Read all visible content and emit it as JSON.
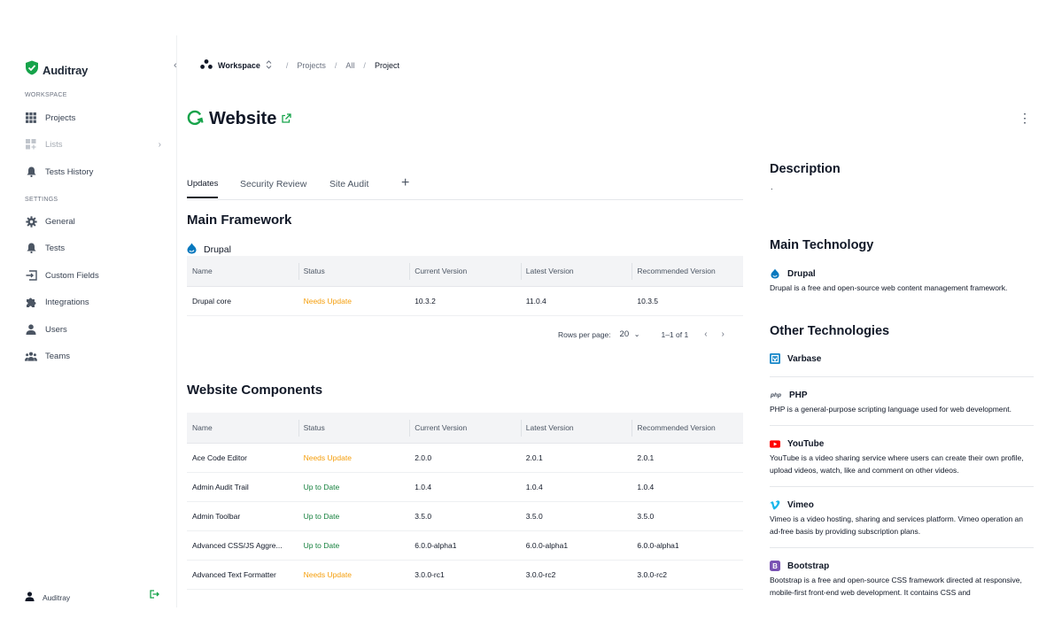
{
  "app": {
    "brand": "Auditray"
  },
  "sidebar": {
    "workspace_label": "WORKSPACE",
    "settings_label": "SETTINGS",
    "workspace_items": [
      {
        "label": "Projects",
        "icon": "grid-icon"
      },
      {
        "label": "Lists",
        "icon": "lists-icon",
        "disabled": true
      },
      {
        "label": "Tests History",
        "icon": "bell-icon"
      }
    ],
    "settings_items": [
      {
        "label": "General",
        "icon": "gear-icon"
      },
      {
        "label": "Tests",
        "icon": "bell-icon"
      },
      {
        "label": "Custom Fields",
        "icon": "custom-fields-icon"
      },
      {
        "label": "Integrations",
        "icon": "puzzle-icon"
      },
      {
        "label": "Users",
        "icon": "user-icon"
      },
      {
        "label": "Teams",
        "icon": "team-icon"
      }
    ],
    "footer_user": "Auditray"
  },
  "breadcrumb": {
    "workspace": "Workspace",
    "items": [
      "Projects",
      "All",
      "Project"
    ],
    "separator": "/"
  },
  "page": {
    "title": "Website"
  },
  "tabs": [
    {
      "label": "Updates",
      "active": true
    },
    {
      "label": "Security Review"
    },
    {
      "label": "Site Audit"
    }
  ],
  "tab_add": "+",
  "main_framework": {
    "title": "Main Framework",
    "name": "Drupal",
    "columns": [
      "Name",
      "Status",
      "Current Version",
      "Latest Version",
      "Recommended Version"
    ],
    "rows": [
      {
        "name": "Drupal core",
        "status": "Needs Update",
        "current": "10.3.2",
        "latest": "11.0.4",
        "recommended": "10.3.5"
      }
    ],
    "pagination": {
      "rows_label": "Rows per page:",
      "rows_value": "20",
      "range": "1–1 of 1"
    }
  },
  "components": {
    "title": "Website Components",
    "columns": [
      "Name",
      "Status",
      "Current Version",
      "Latest Version",
      "Recommended Version"
    ],
    "rows": [
      {
        "name": "Ace Code Editor",
        "status": "Needs Update",
        "current": "2.0.0",
        "latest": "2.0.1",
        "recommended": "2.0.1"
      },
      {
        "name": "Admin Audit Trail",
        "status": "Up to Date",
        "current": "1.0.4",
        "latest": "1.0.4",
        "recommended": "1.0.4"
      },
      {
        "name": "Admin Toolbar",
        "status": "Up to Date",
        "current": "3.5.0",
        "latest": "3.5.0",
        "recommended": "3.5.0"
      },
      {
        "name": "Advanced CSS/JS Aggre...",
        "status": "Up to Date",
        "current": "6.0.0-alpha1",
        "latest": "6.0.0-alpha1",
        "recommended": "6.0.0-alpha1"
      },
      {
        "name": "Advanced Text Formatter",
        "status": "Needs Update",
        "current": "3.0.0-rc1",
        "latest": "3.0.0-rc2",
        "recommended": "3.0.0-rc2"
      }
    ]
  },
  "right_panel": {
    "description_title": "Description",
    "description_text": ".",
    "main_tech_title": "Main Technology",
    "main_tech": {
      "name": "Drupal",
      "desc": "Drupal is a free and open-source web content management framework."
    },
    "other_title": "Other Technologies",
    "other": [
      {
        "name": "Varbase",
        "desc": ""
      },
      {
        "name": "PHP",
        "desc": "PHP is a general-purpose scripting language used for web development.",
        "icon_text": "php"
      },
      {
        "name": "YouTube",
        "desc": "YouTube is a video sharing service where users can create their own profile, upload videos, watch, like and comment on other videos."
      },
      {
        "name": "Vimeo",
        "desc": "Vimeo is a video hosting, sharing and services platform. Vimeo operation an ad-free basis by providing subscription plans."
      },
      {
        "name": "Bootstrap",
        "desc": "Bootstrap is a free and open-source CSS framework directed at responsive, mobile-first front-end web development. It contains CSS and",
        "icon_text": "B"
      }
    ]
  },
  "colors": {
    "brand_green": "#16a34a",
    "warning": "#f59e0b",
    "success": "#15803d",
    "drupal_blue": "#0678be",
    "youtube_red": "#ff0000",
    "vimeo_blue": "#1ab7ea",
    "bootstrap_purple": "#7952b3"
  }
}
